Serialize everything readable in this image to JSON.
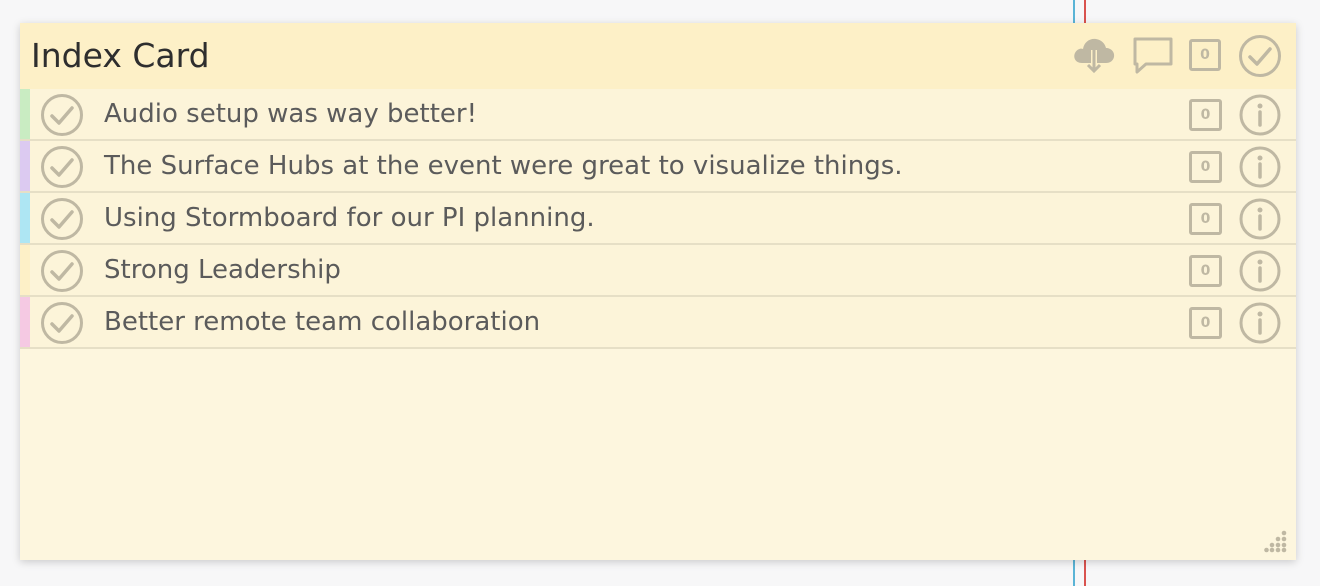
{
  "card": {
    "title": "Index Card",
    "header_vote_count": "0",
    "rows": [
      {
        "text": "Audio setup was way better!",
        "vote_count": "0",
        "color": "#c9ecc2"
      },
      {
        "text": "The Surface Hubs at the event were great to visualize things.",
        "vote_count": "0",
        "color": "#dccaf1"
      },
      {
        "text": "Using Stormboard for our PI planning.",
        "vote_count": "0",
        "color": "#aee6f3"
      },
      {
        "text": "Strong Leadership",
        "vote_count": "0",
        "color": "#fdf0c7"
      },
      {
        "text": "Better remote team collaboration",
        "vote_count": "0",
        "color": "#f5c9e3"
      }
    ]
  },
  "icons": {
    "cloud": "cloud-download-icon",
    "comment": "comment-icon",
    "check": "check-circle-icon",
    "info": "info-icon",
    "resize": "resize-handle-icon"
  },
  "colors": {
    "card_background": "#fdf6de",
    "header_background": "#fdf0c7",
    "icon_color": "#bfb8a3",
    "guide_blue": "#5ab4d6",
    "guide_red": "#d9534f"
  }
}
